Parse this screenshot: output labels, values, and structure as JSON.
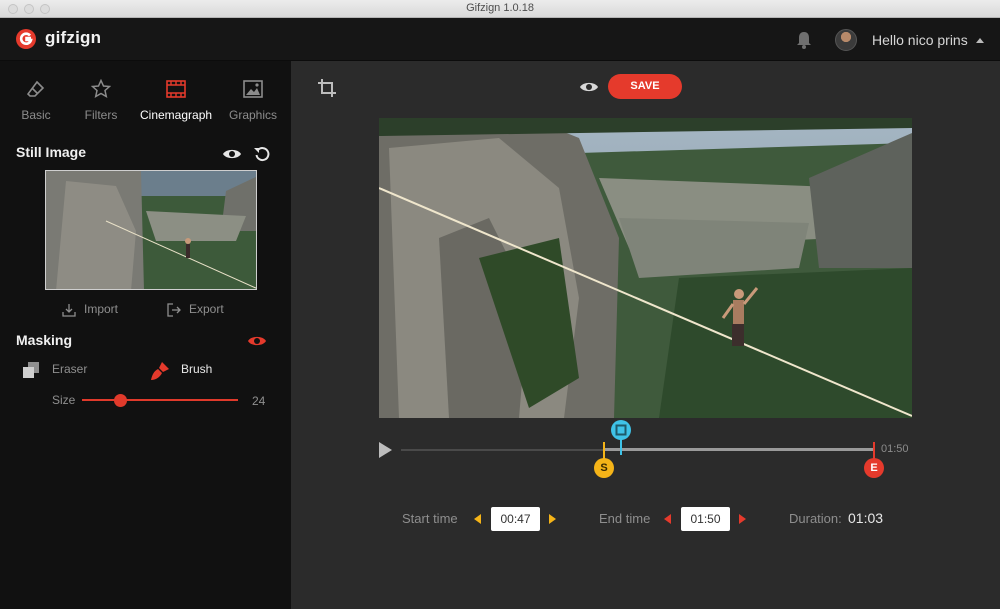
{
  "window": {
    "title": "Gifzign 1.0.18"
  },
  "header": {
    "logo_text": "gifzign",
    "greeting": "Hello nico prins"
  },
  "tabs": [
    {
      "label": "Basic",
      "icon": "eraser-icon",
      "active": false
    },
    {
      "label": "Filters",
      "icon": "star-icon",
      "active": false
    },
    {
      "label": "Cinemagraph",
      "icon": "film-icon",
      "active": true
    },
    {
      "label": "Graphics",
      "icon": "image-icon",
      "active": false
    }
  ],
  "still_image": {
    "title": "Still Image",
    "import_label": "Import",
    "export_label": "Export"
  },
  "masking": {
    "title": "Masking",
    "eraser_label": "Eraser",
    "brush_label": "Brush",
    "active_tool": "Brush",
    "size_label": "Size",
    "size_value": "24",
    "size_fraction": 0.21
  },
  "toolbar": {
    "save_label": "SAVE"
  },
  "timeline": {
    "end_label": "01:50",
    "start_marker": "S",
    "end_marker": "E",
    "start_fraction": 0.43,
    "playhead_fraction": 0.47,
    "end_fraction": 1.0
  },
  "times": {
    "start_label": "Start time",
    "start_value": "00:47",
    "end_label": "End time",
    "end_value": "01:50",
    "duration_label": "Duration:",
    "duration_value": "01:03"
  },
  "colors": {
    "accent": "#e53a2c",
    "start_marker": "#f5b418",
    "playhead": "#3fc3e8",
    "sidebar_bg": "#111111",
    "main_bg": "#2b2b2b"
  }
}
